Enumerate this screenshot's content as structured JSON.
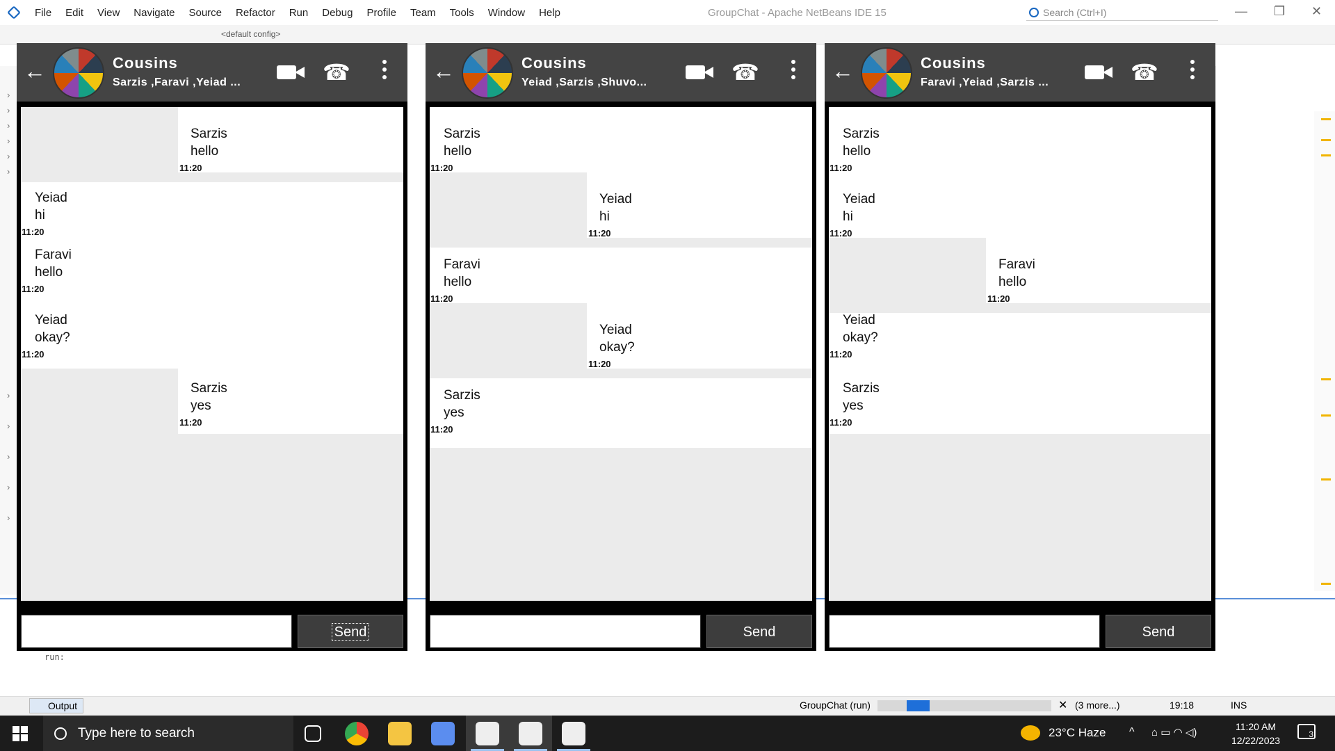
{
  "ide": {
    "title": "GroupChat - Apache NetBeans IDE 15",
    "menu": [
      "File",
      "Edit",
      "View",
      "Navigate",
      "Source",
      "Refactor",
      "Run",
      "Debug",
      "Profile",
      "Team",
      "Tools",
      "Window",
      "Help"
    ],
    "search_placeholder": "Search (Ctrl+I)",
    "config": "<default config>",
    "output_tab": "Output",
    "output_text": "run:",
    "status_task": "GroupChat (run)",
    "status_progress": 0.33,
    "status_more": "(3 more...)",
    "status_position": "19:18",
    "status_mode": "INS"
  },
  "taskbar": {
    "search_placeholder": "Type here to search",
    "weather": "23°C  Haze",
    "time": "11:20 AM",
    "date": "12/22/2023",
    "notifications": "3"
  },
  "chats": [
    {
      "group_name": "Cousins",
      "members": "Sarzis ,Faravi ,Yeiad ...",
      "send_label": "Send",
      "messages": [
        {
          "sender": "Sarzis",
          "text": "hello",
          "time": "11:20",
          "side": "right"
        },
        {
          "sender": "Yeiad",
          "text": "hi",
          "time": "11:20",
          "side": "left"
        },
        {
          "sender": "Faravi",
          "text": "hello",
          "time": "11:20",
          "side": "left"
        },
        {
          "sender": "Yeiad",
          "text": "okay?",
          "time": "11:20",
          "side": "left"
        },
        {
          "sender": "Sarzis",
          "text": "yes",
          "time": "11:20",
          "side": "right"
        }
      ]
    },
    {
      "group_name": "Cousins",
      "members": "Yeiad ,Sarzis ,Shuvo...",
      "send_label": "Send",
      "messages": [
        {
          "sender": "Sarzis",
          "text": "hello",
          "time": "11:20",
          "side": "left"
        },
        {
          "sender": "Yeiad",
          "text": "hi",
          "time": "11:20",
          "side": "right"
        },
        {
          "sender": "Faravi",
          "text": "hello",
          "time": "11:20",
          "side": "left"
        },
        {
          "sender": "Yeiad",
          "text": "okay?",
          "time": "11:20",
          "side": "right"
        },
        {
          "sender": "Sarzis",
          "text": "yes",
          "time": "11:20",
          "side": "left"
        }
      ]
    },
    {
      "group_name": "Cousins",
      "members": "Faravi ,Yeiad ,Sarzis ...",
      "send_label": "Send",
      "messages": [
        {
          "sender": "Sarzis",
          "text": "hello",
          "time": "11:20",
          "side": "left"
        },
        {
          "sender": "Yeiad",
          "text": "hi",
          "time": "11:20",
          "side": "left"
        },
        {
          "sender": "Faravi",
          "text": "hello",
          "time": "11:20",
          "side": "right"
        },
        {
          "sender": "Yeiad",
          "text": "okay?",
          "time": "11:20",
          "side": "left"
        },
        {
          "sender": "Sarzis",
          "text": "yes",
          "time": "11:20",
          "side": "left"
        }
      ]
    }
  ],
  "colors": {
    "header_bg": "#444444",
    "chat_bg": "#ebebeb",
    "bubble_bg": "#ffffff",
    "send_bg": "#3d3d3d",
    "progress": "#1e6fd9"
  }
}
